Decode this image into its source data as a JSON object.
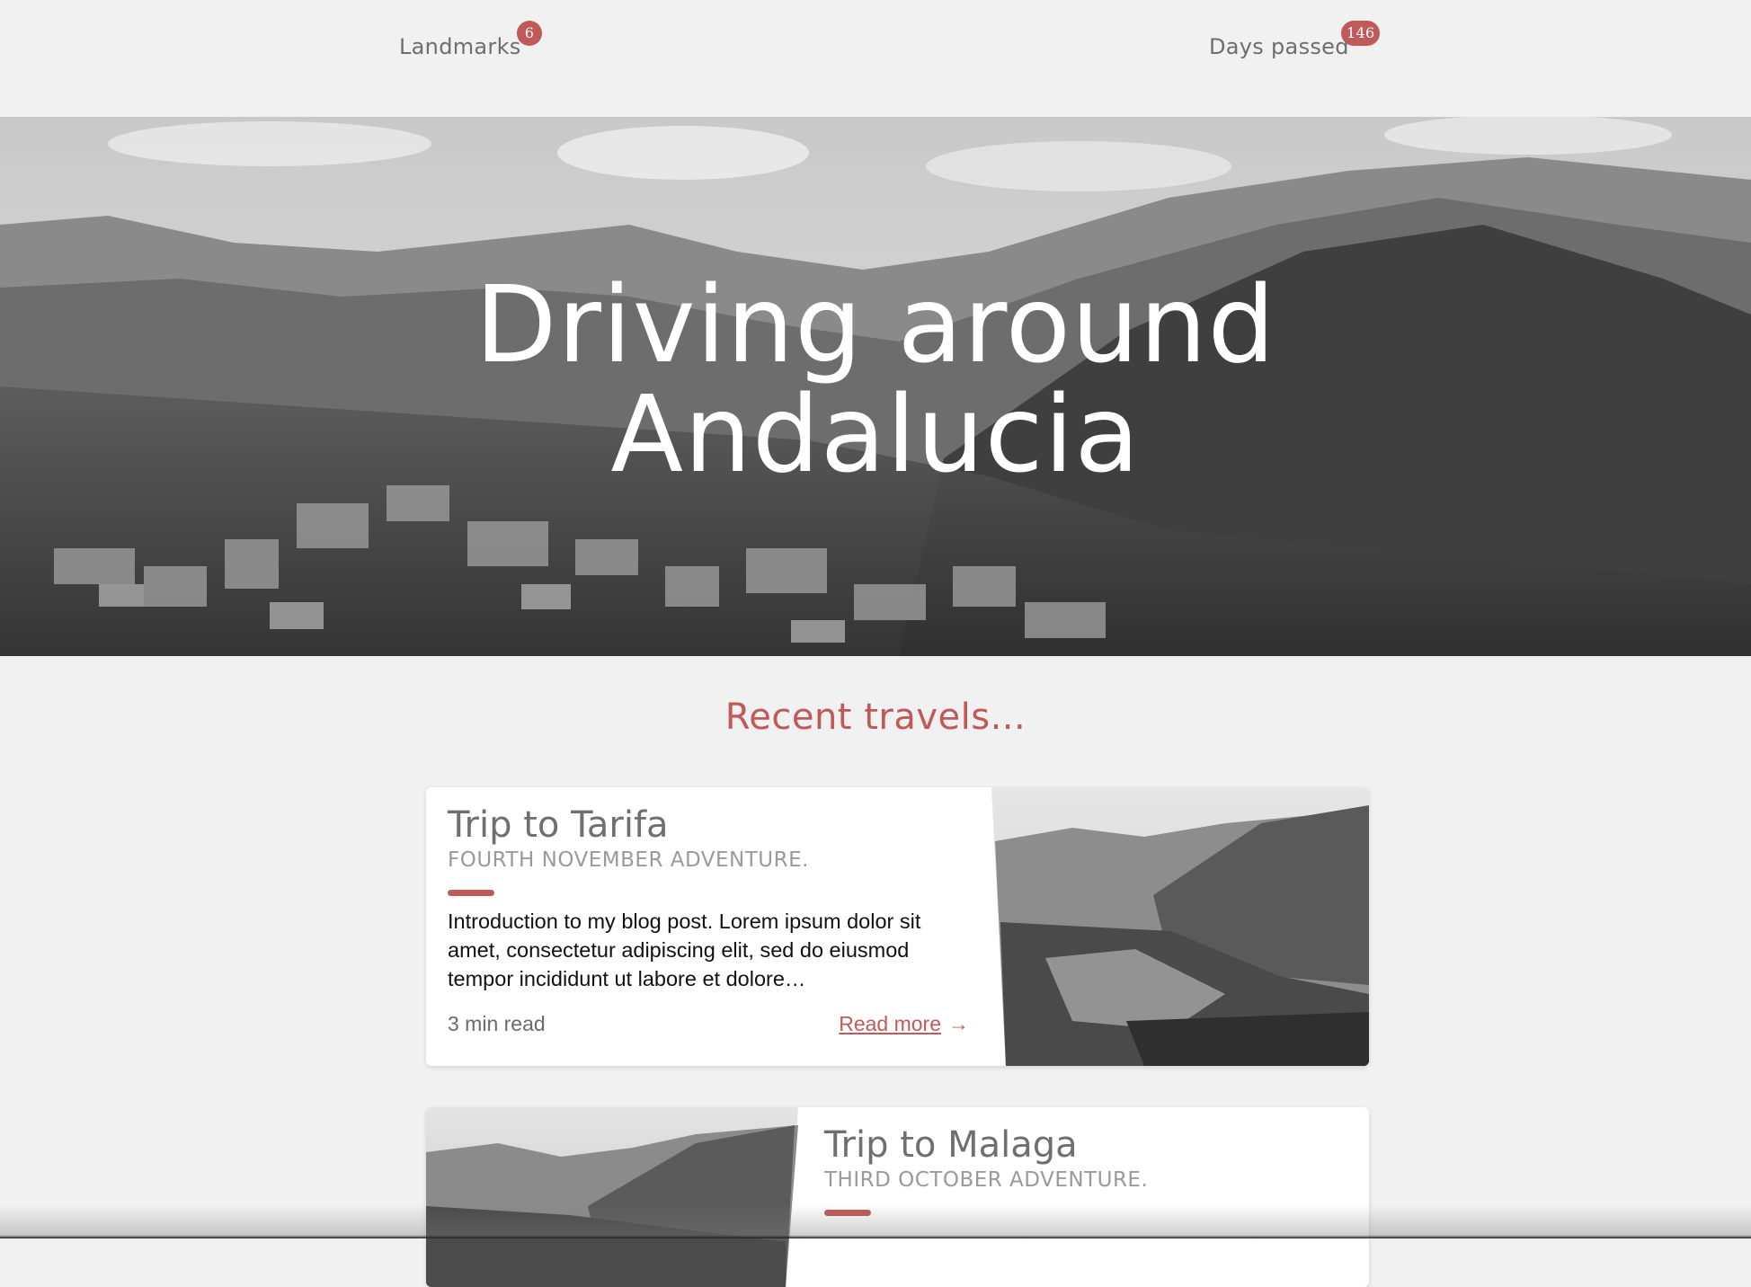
{
  "stats": {
    "landmarks": {
      "label": "Landmarks",
      "count": "6"
    },
    "days": {
      "label": "Days passed",
      "count": "146"
    }
  },
  "hero": {
    "title": "Driving around Andalucia",
    "line1": "Driving around",
    "line2": "Andalucia"
  },
  "section": {
    "title": "Recent travels..."
  },
  "cards": [
    {
      "title": "Trip to Tarifa",
      "subtitle": "FOURTH NOVEMBER ADVENTURE.",
      "excerpt": "Introduction to my blog post. Lorem ipsum dolor sit amet, consectetur adipiscing elit, sed do eiusmod tempor incididunt ut labore et dolore…",
      "read_time": "3 min read",
      "read_more": "Read more"
    },
    {
      "title": "Trip to Malaga",
      "subtitle": "THIRD OCTOBER ADVENTURE."
    }
  ],
  "colors": {
    "accent": "#c05a58",
    "background": "#f1f1f1"
  },
  "icons": {
    "read_more_arrow": "arrow-right-icon"
  }
}
